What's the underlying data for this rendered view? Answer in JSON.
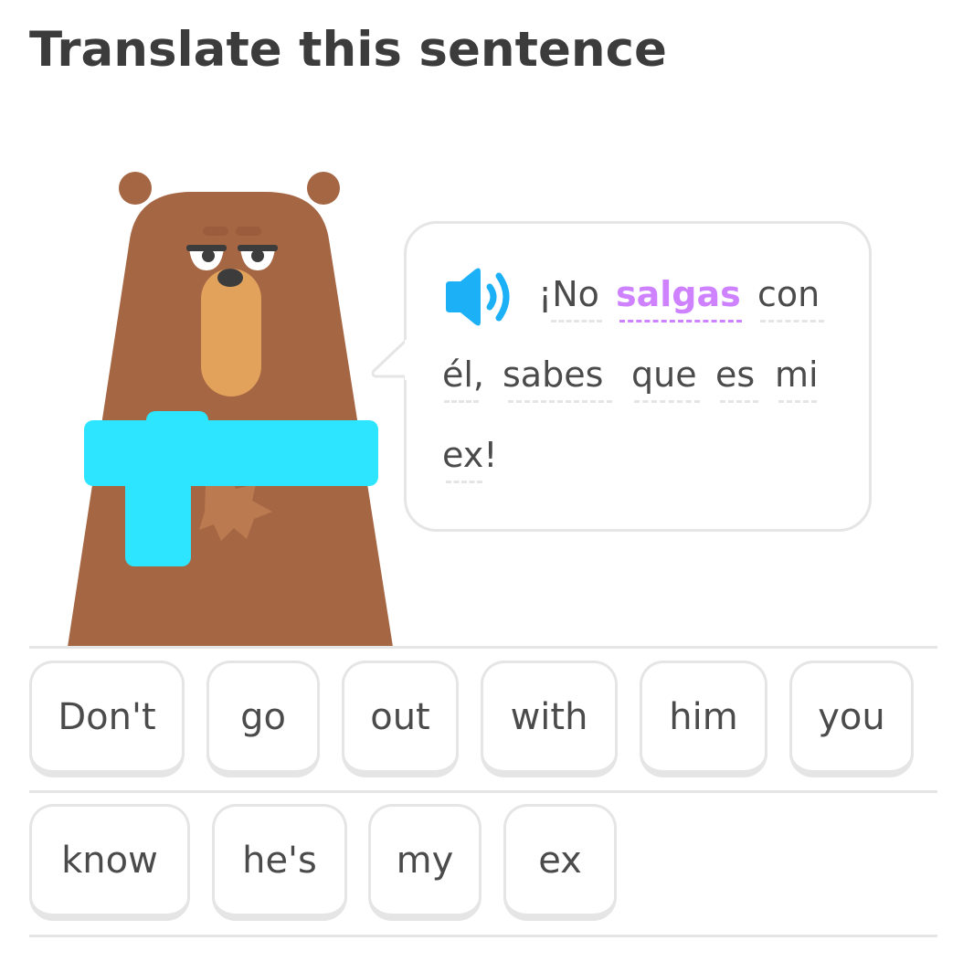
{
  "header": {
    "title": "Translate this sentence"
  },
  "prompt": {
    "audio_icon": "speaker-icon",
    "highlight_color": "#ce82ff",
    "words": [
      "¡No",
      "salgas",
      "con",
      "él,",
      "sabes",
      "que",
      "es",
      "mi",
      "ex!"
    ],
    "highlighted_word": "salgas"
  },
  "word_bank": {
    "row1": [
      "Don't",
      "go",
      "out",
      "with",
      "him",
      "you"
    ],
    "row2": [
      "know",
      "he's",
      "my",
      "ex"
    ]
  },
  "colors": {
    "bear_body": "#a56644",
    "scarf": "#2ee5ff",
    "muzzle": "#e3a25c",
    "speaker": "#1cb0f6",
    "border": "#e5e5e5"
  }
}
